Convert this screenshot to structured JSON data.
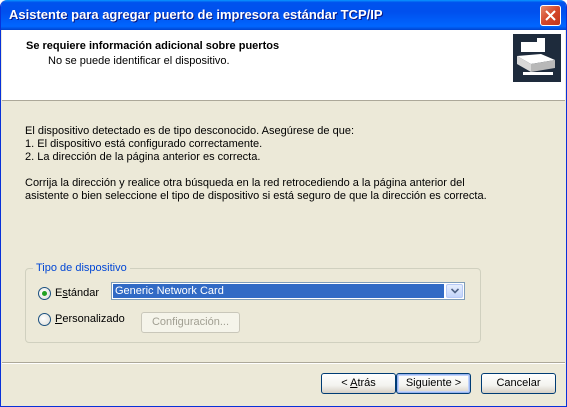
{
  "window": {
    "title": "Asistente para agregar puerto de impresora estándar TCP/IP"
  },
  "header": {
    "title": "Se requiere información adicional sobre puertos",
    "subtitle": "No se puede identificar el dispositivo."
  },
  "body": {
    "line1": "El dispositivo detectado es de tipo desconocido.  Asegúrese de que:",
    "line2": "1. El dispositivo está configurado correctamente.",
    "line3": "2. La dirección de la página anterior es correcta.",
    "para2_line1": "Corrija la dirección y realice otra búsqueda en la red retrocediendo a la página anterior del",
    "para2_line2": "asistente o bien seleccione el tipo de dispositivo si está seguro de que la dirección es correcta."
  },
  "device_type": {
    "legend": "Tipo de dispositivo",
    "standard": {
      "label_pre": "E",
      "label_accel": "s",
      "label_post": "tándar",
      "selected": true
    },
    "standard_select_value": "Generic Network Card",
    "custom": {
      "label_pre": "",
      "label_accel": "P",
      "label_post": "ersonalizado",
      "selected": false
    },
    "config_button": "Configuración..."
  },
  "buttons": {
    "back": {
      "pre": "< ",
      "accel": "A",
      "post": "trás"
    },
    "next": {
      "pre": "Siguiente",
      "accel": "",
      "post": " >"
    },
    "cancel": "Cancelar"
  },
  "colors": {
    "titlebar": "#0054E3",
    "face": "#ECE9D8",
    "selection": "#316AC5",
    "groupbox_label": "#0046D5"
  }
}
